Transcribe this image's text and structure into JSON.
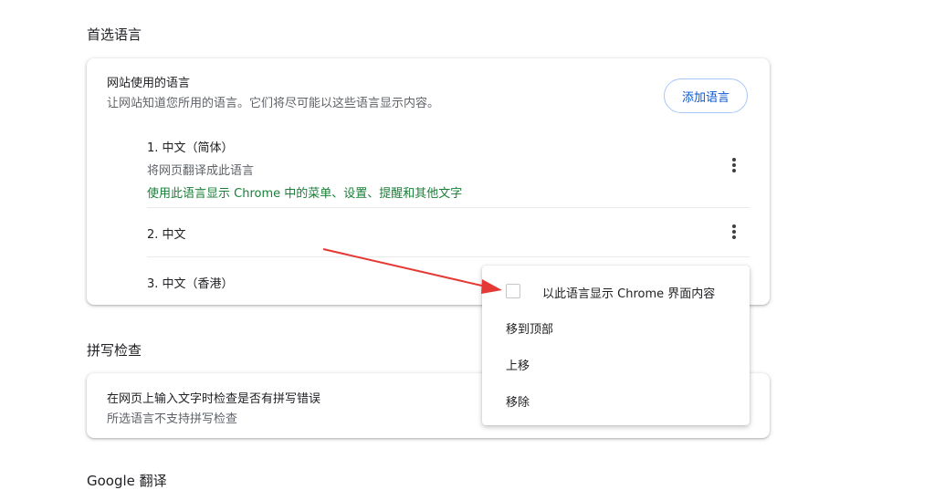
{
  "sections": {
    "preferred_languages": "首选语言",
    "spell_check": "拼写检查",
    "google_translate": "Google 翻译"
  },
  "website_languages": {
    "title": "网站使用的语言",
    "subtitle": "让网站知道您所用的语言。它们将尽可能以这些语言显示内容。",
    "add_button": "添加语言",
    "items": [
      {
        "name": "1. 中文（简体）",
        "translate_note": "将网页翻译成此语言",
        "display_note": "使用此语言显示 Chrome 中的菜单、设置、提醒和其他文字"
      },
      {
        "name": "2. 中文"
      },
      {
        "name": "3. 中文（香港）"
      }
    ]
  },
  "context_menu": {
    "display_chrome_in_language": "以此语言显示 Chrome 界面内容",
    "move_to_top": "移到顶部",
    "move_up": "上移",
    "remove": "移除"
  },
  "spell_check_card": {
    "title": "在网页上输入文字时检查是否有拼写错误",
    "subtitle": "所选语言不支持拼写检查"
  },
  "colors": {
    "accent_blue": "#0b57d0",
    "green_note": "#188038",
    "arrow_red": "#e53935"
  }
}
